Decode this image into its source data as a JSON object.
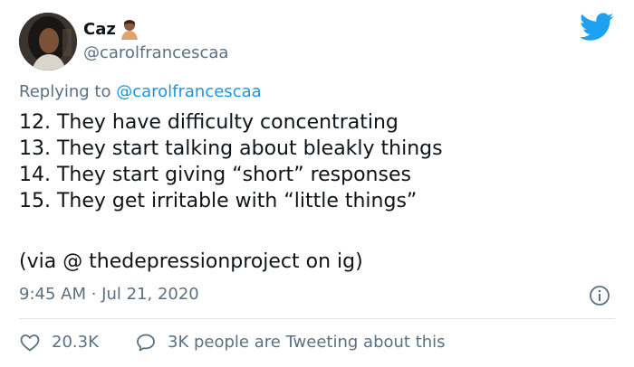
{
  "author": {
    "display_name": "Caz",
    "handle": "@carolfrancescaa"
  },
  "reply_context": {
    "prefix": "Replying to",
    "mention": "@carolfrancescaa"
  },
  "body": {
    "lines": [
      "12. They have difficulty concentrating",
      "13. They start talking about bleakly things",
      "14. They start giving “short” responses",
      "15. They get irritable with “little things”"
    ],
    "source": "(via @ thedepressionproject on ig)"
  },
  "meta": {
    "timestamp": "9:45 AM · Jul 21, 2020"
  },
  "actions": {
    "likes": "20.3K",
    "conversation": "3K people are Tweeting about this"
  },
  "icons": {
    "brand": "twitter-bird-icon",
    "info": "info-icon",
    "like": "heart-icon",
    "conversation": "speech-bubble-icon"
  },
  "colors": {
    "twitter_blue": "#1da1f2",
    "link_blue": "#1b95e0",
    "muted_text": "#5b7083",
    "body_text": "#0f1419",
    "divider": "#dfe6eb"
  }
}
